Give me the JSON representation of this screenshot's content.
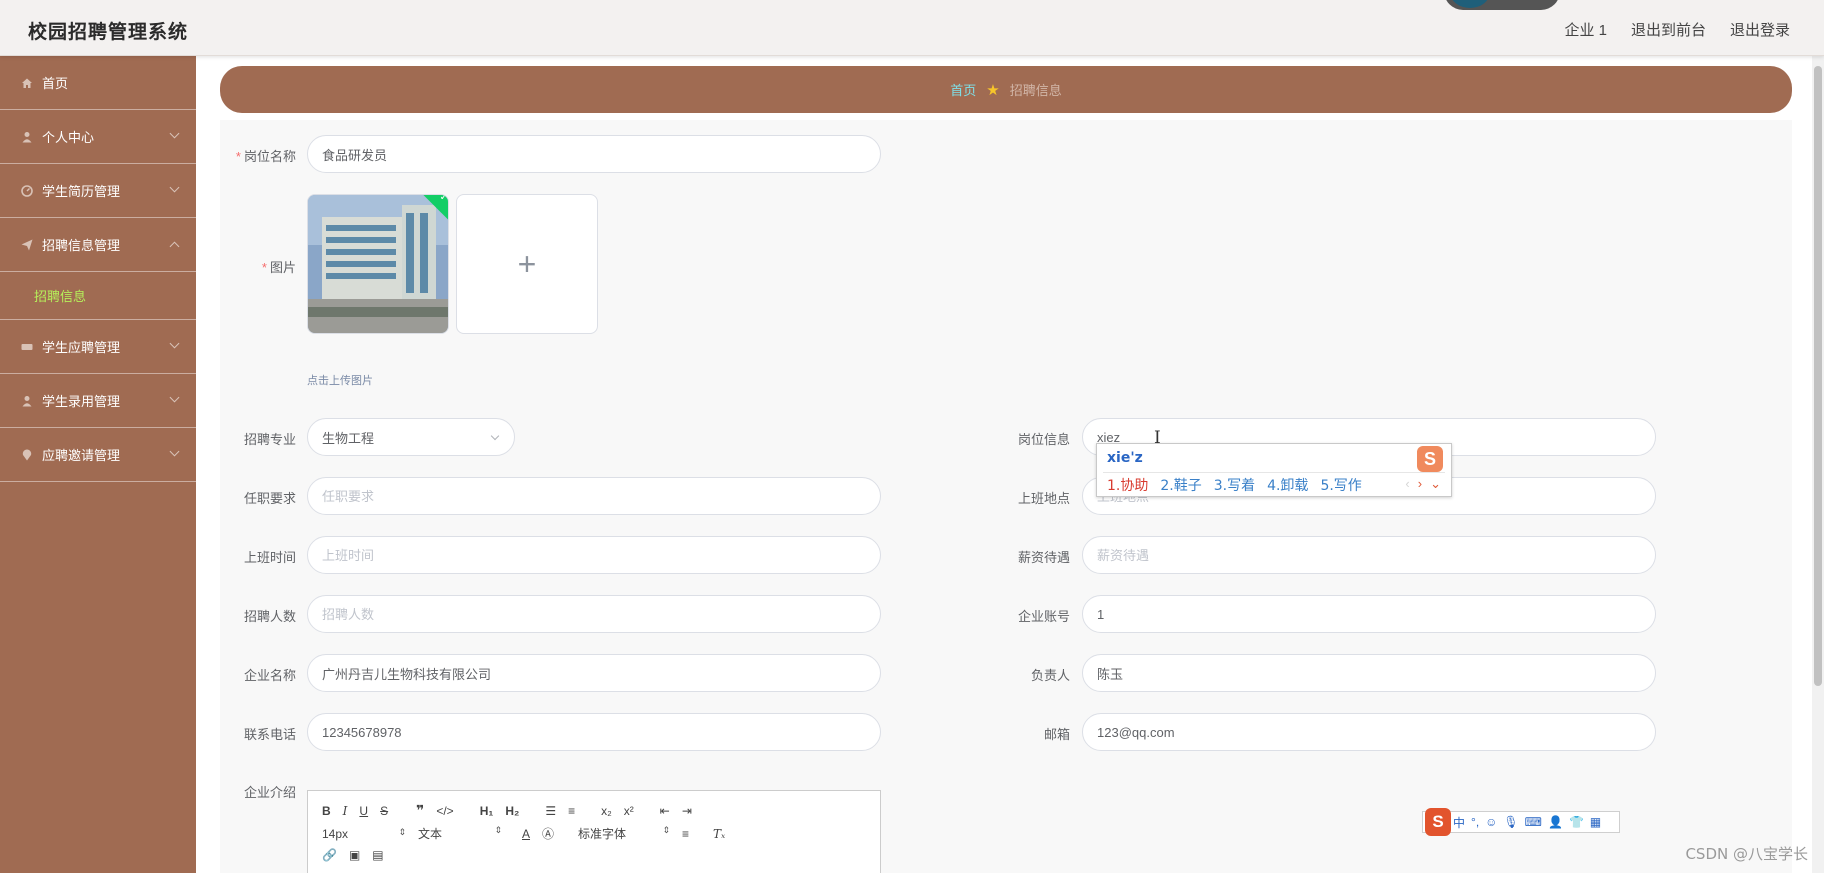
{
  "app": {
    "title": "校园招聘管理系统"
  },
  "topnav": {
    "user": "企业 1",
    "front": "退出到前台",
    "logout": "退出登录"
  },
  "sidebar": {
    "items": [
      {
        "label": "首页"
      },
      {
        "label": "个人中心"
      },
      {
        "label": "学生简历管理"
      },
      {
        "label": "招聘信息管理"
      },
      {
        "label": "学生应聘管理"
      },
      {
        "label": "学生录用管理"
      },
      {
        "label": "应聘邀请管理"
      }
    ],
    "submenu": {
      "label": "招聘信息"
    }
  },
  "breadcrumb": {
    "home": "首页",
    "current": "招聘信息"
  },
  "form": {
    "job_name": {
      "label": "岗位名称",
      "value": "食品研发员"
    },
    "image": {
      "label": "图片",
      "tip": "点击上传图片"
    },
    "major": {
      "label": "招聘专业",
      "value": "生物工程"
    },
    "job_info": {
      "label": "岗位信息",
      "value": "xiez"
    },
    "requirements": {
      "label": "任职要求",
      "placeholder": "任职要求"
    },
    "location": {
      "label": "上班地点",
      "placeholder": "上班地点"
    },
    "work_time": {
      "label": "上班时间",
      "placeholder": "上班时间"
    },
    "salary": {
      "label": "薪资待遇",
      "placeholder": "薪资待遇"
    },
    "headcount": {
      "label": "招聘人数",
      "placeholder": "招聘人数"
    },
    "company_account": {
      "label": "企业账号",
      "value": "1"
    },
    "company_name": {
      "label": "企业名称",
      "value": "广州丹吉儿生物科技有限公司"
    },
    "contact_person": {
      "label": "负责人",
      "value": "陈玉"
    },
    "phone": {
      "label": "联系电话",
      "value": "12345678978"
    },
    "email": {
      "label": "邮箱",
      "value": "123@qq.com"
    },
    "intro": {
      "label": "企业介绍"
    }
  },
  "editor": {
    "font_size": "14px",
    "text_type": "文本",
    "font_family": "标准字体"
  },
  "ime": {
    "pinyin": "xie'z",
    "candidates": [
      "1.协助",
      "2.鞋子",
      "3.写着",
      "4.卸载",
      "5.写作"
    ]
  },
  "ime_bar": {
    "mode": "中"
  },
  "watermark": "CSDN @八宝学长",
  "colors": {
    "sidebar": "#a06b52",
    "accent_green": "#b6f05a",
    "breadcrumb_home": "#7fe0e8"
  }
}
